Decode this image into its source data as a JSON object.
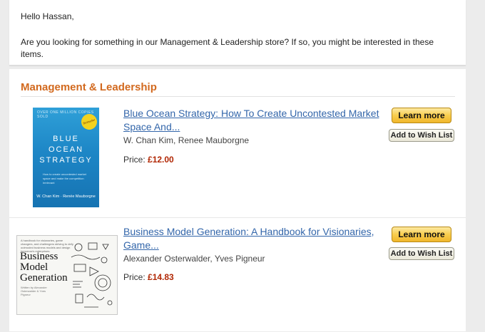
{
  "email": {
    "greeting": "Hello Hassan,",
    "intro": "Are you looking for something in our Management & Leadership store? If so, you might be interested in these items."
  },
  "section": {
    "title": "Management & Leadership"
  },
  "labels": {
    "price_prefix": "Price: ",
    "learn_more": "Learn more",
    "add_to_wish_list": "Add to Wish List"
  },
  "products": [
    {
      "title": "Blue Ocean Strategy: How To Create Uncontested Market Space And...",
      "authors": "W. Chan Kim, Renee Mauborgne",
      "price": "£12.00",
      "cover_color": "#1d86c6",
      "cover_text": {
        "top": "OVER ONE MILLION COPIES SOLD",
        "badge": "Bestseller",
        "line1": "BLUE",
        "line2": "OCEAN",
        "line3": "STRATEGY",
        "subtitle": "How to create uncontested market space and make the competition irrelevant",
        "authors": "W. Chan Kim · Renée Mauborgne"
      }
    },
    {
      "title": "Business Model Generation: A Handbook for Visionaries, Game...",
      "authors": "Alexander Osterwalder, Yves Pigneur",
      "price": "£14.83",
      "cover_color": "#f7f7f4",
      "cover_text": {
        "small": "A handbook for visionaries, game changers, and challengers striving to defy outmoded business models and design tomorrow's enterprises.",
        "title_line1": "Business",
        "title_line2": "Model",
        "title_line3": "Generation",
        "credits": "Written by Alexander Osterwalder & Yves Pigneur"
      }
    }
  ],
  "colors": {
    "section_title": "#d2691e",
    "link": "#3366aa",
    "price": "#b12704",
    "learn_more_button": "#f8cd4e"
  }
}
